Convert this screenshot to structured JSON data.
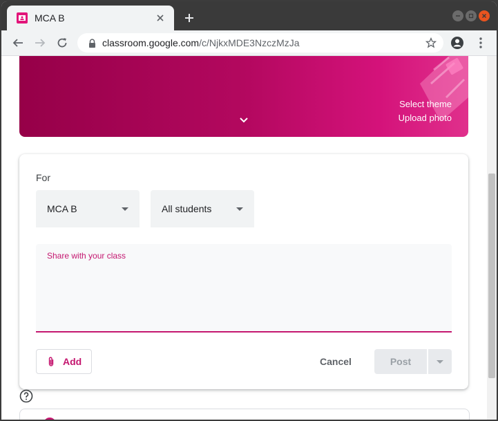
{
  "browser": {
    "tab_title": "MCA B",
    "url_host": "classroom.google.com",
    "url_path": "/c/NjkxMDE3NzczMzJa"
  },
  "banner": {
    "select_theme": "Select theme",
    "upload_photo": "Upload photo"
  },
  "composer": {
    "for_label": "For",
    "class_select": "MCA B",
    "students_select": "All students",
    "share_label": "Share with your class",
    "add_label": "Add",
    "cancel_label": "Cancel",
    "post_label": "Post"
  },
  "colors": {
    "accent": "#c4166f",
    "banner_start": "#960048",
    "banner_end": "#e0308c"
  }
}
